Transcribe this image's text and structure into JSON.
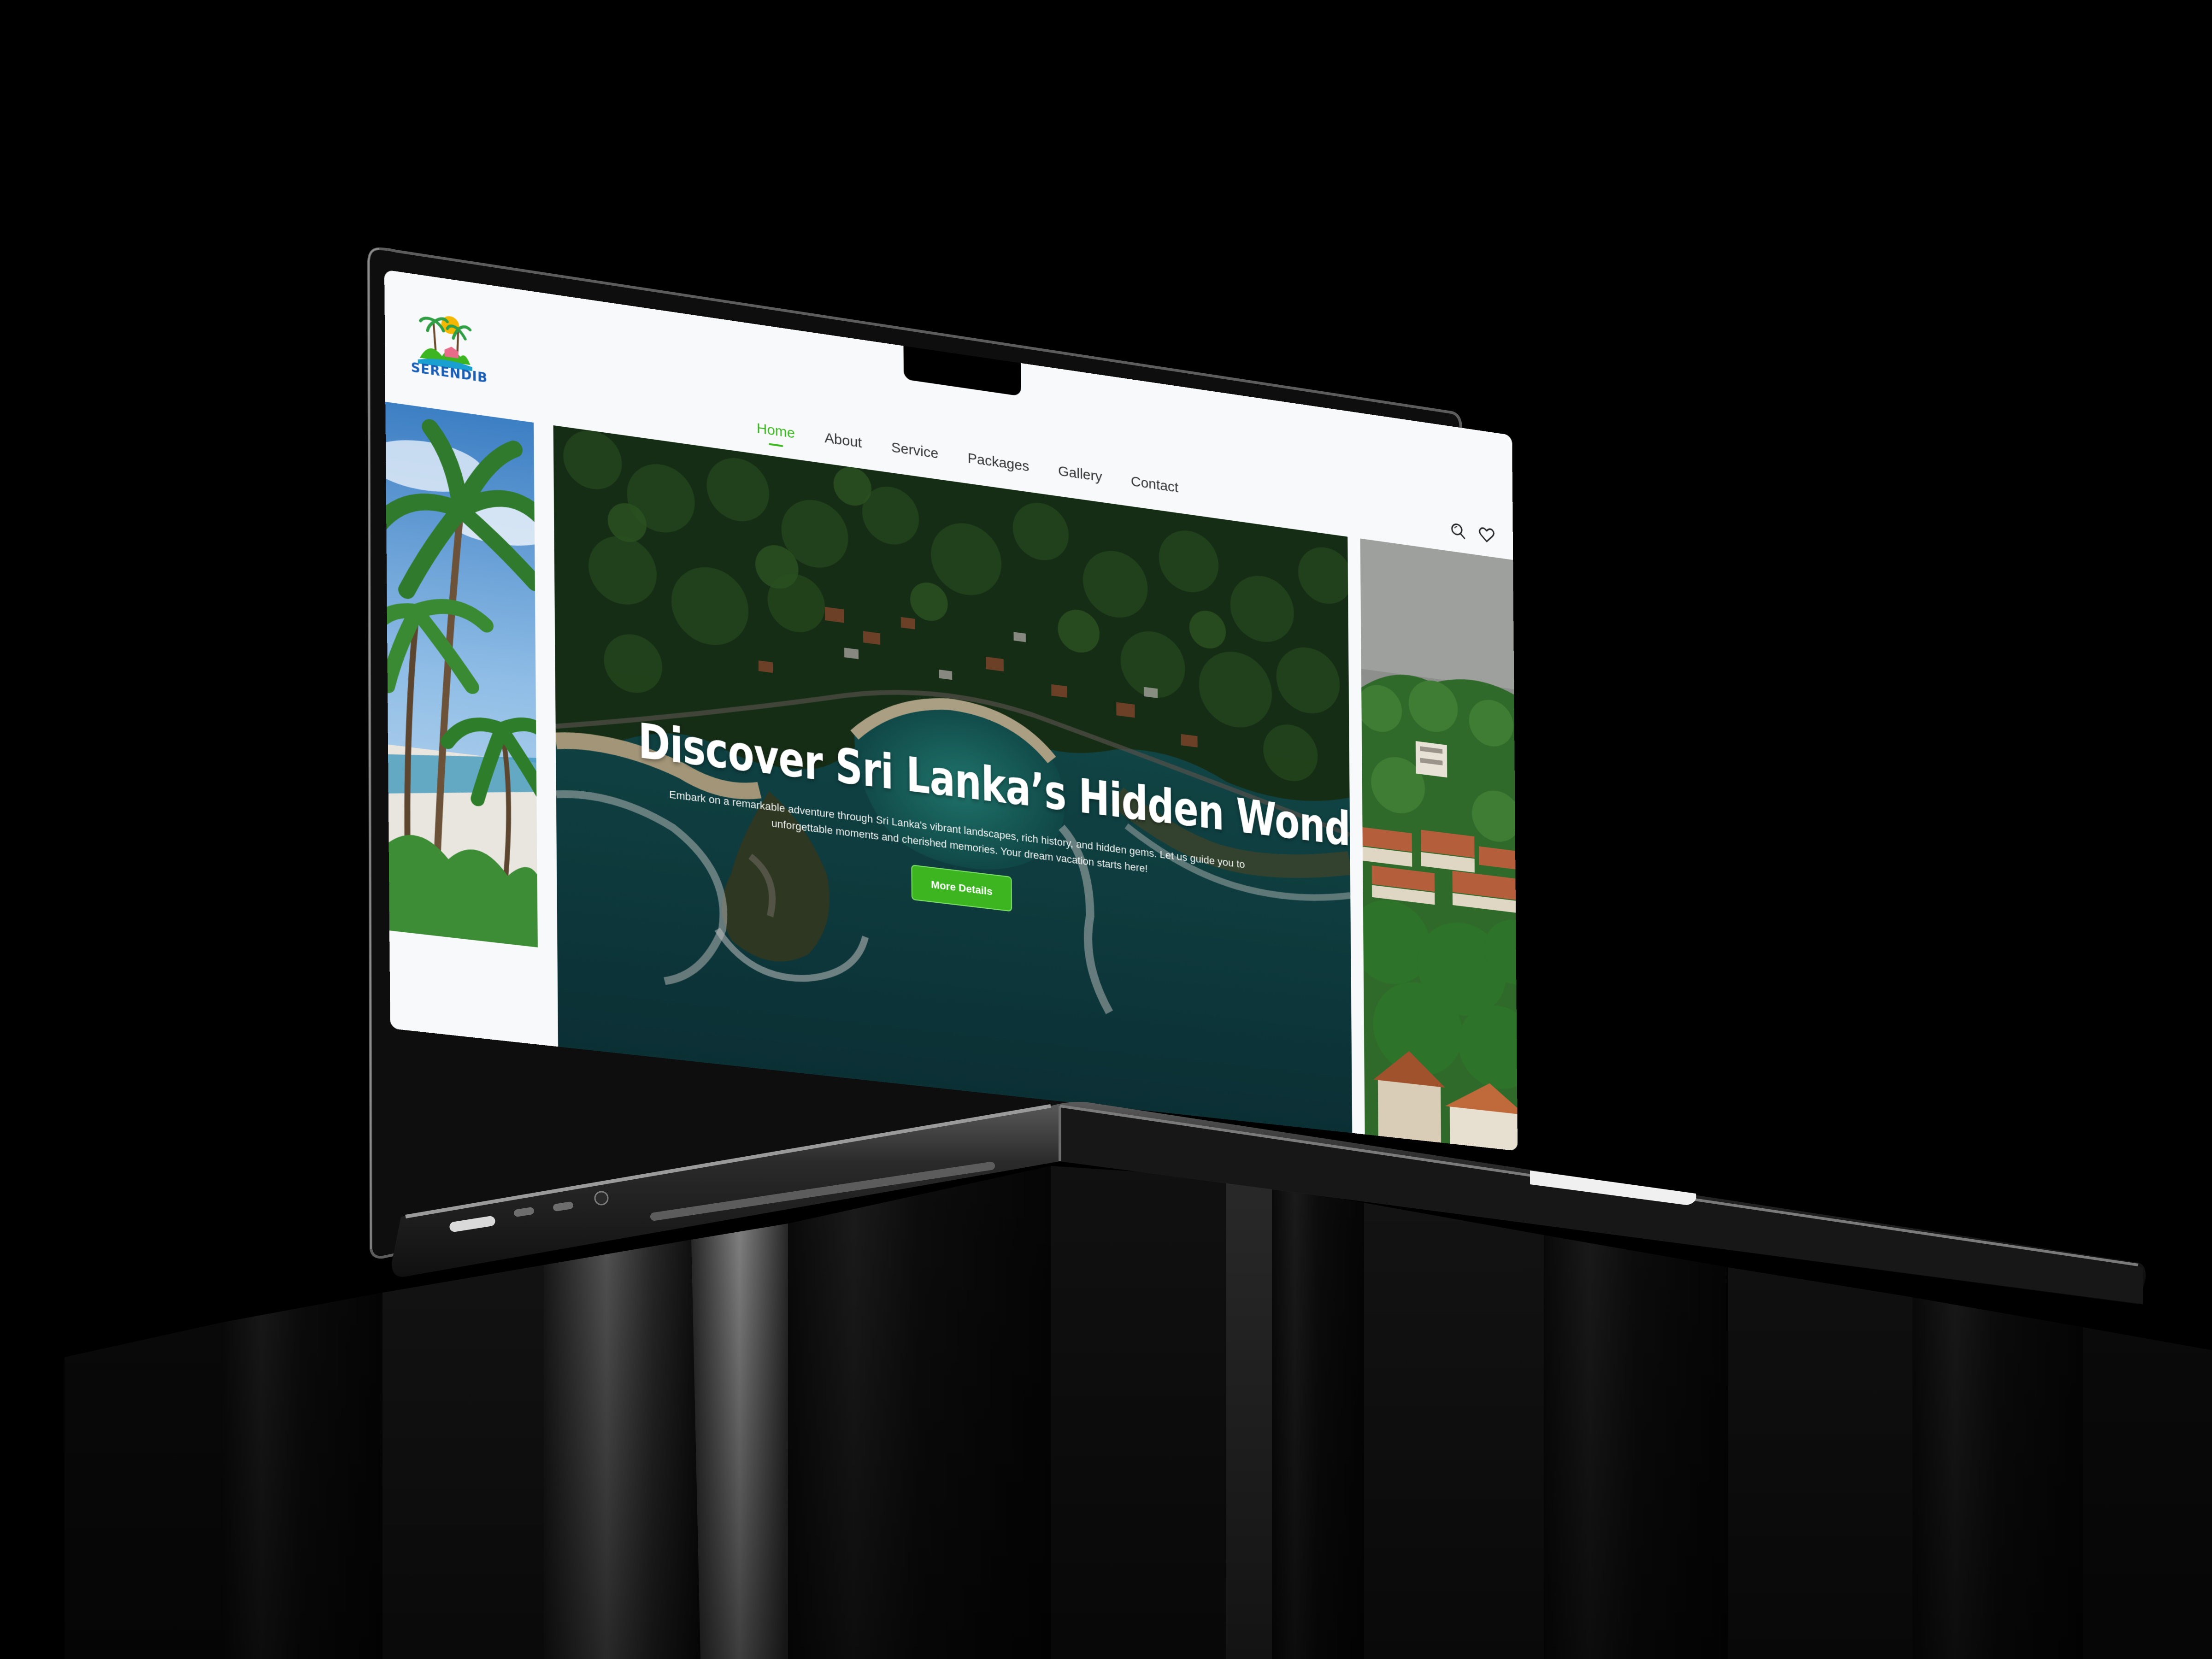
{
  "brand": {
    "name": "SERENDIB"
  },
  "nav": {
    "items": [
      {
        "label": "Home",
        "active": true
      },
      {
        "label": "About",
        "active": false
      },
      {
        "label": "Service",
        "active": false
      },
      {
        "label": "Packages",
        "active": false
      },
      {
        "label": "Gallery",
        "active": false
      },
      {
        "label": "Contact",
        "active": false
      }
    ],
    "icons": [
      "search-icon",
      "heart-icon"
    ]
  },
  "hero": {
    "title": "Discover Sri Lanka’s Hidden Wonders",
    "subtitle": "Embark on a remarkable adventure through Sri Lanka's vibrant landscapes, rich history, and hidden gems. Let us guide you to unforgettable moments and cherished memories. Your dream vacation starts here!",
    "button_label": "More Details"
  },
  "colors": {
    "accent": "#3cb521",
    "brand_blue": "#1a5fb4",
    "page_background": "#f8f9fa",
    "scene_background": "#000000"
  }
}
